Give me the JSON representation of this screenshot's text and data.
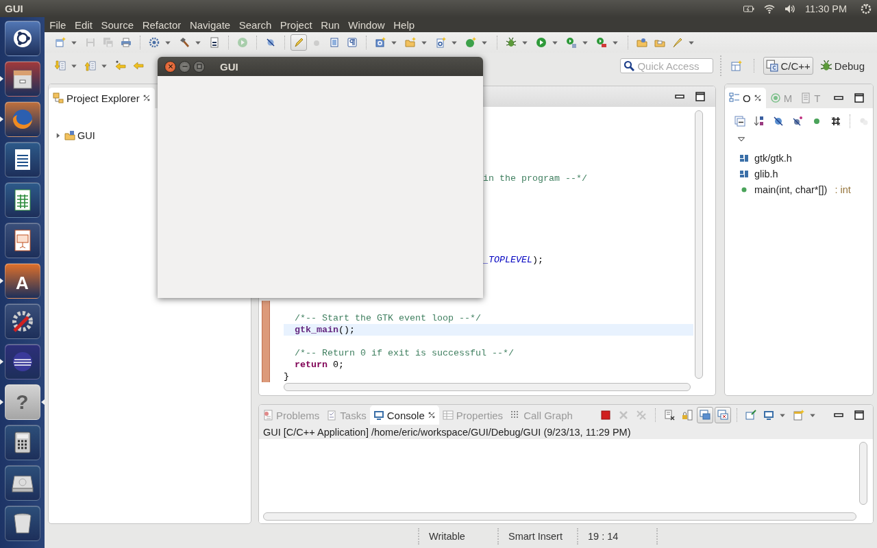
{
  "top_panel": {
    "app_title": "GUI",
    "clock": "11:30 PM"
  },
  "launcher": [
    {
      "kind": "ubuntu",
      "running": false,
      "focused": false
    },
    {
      "kind": "files",
      "running": true,
      "focused": false
    },
    {
      "kind": "firefox",
      "running": true,
      "focused": false
    },
    {
      "kind": "writer",
      "running": false,
      "focused": false
    },
    {
      "kind": "calc",
      "running": false,
      "focused": false
    },
    {
      "kind": "impress",
      "running": false,
      "focused": false
    },
    {
      "kind": "software",
      "running": true,
      "focused": false,
      "glyph": "A"
    },
    {
      "kind": "settings",
      "running": false,
      "focused": false
    },
    {
      "kind": "eclipse",
      "running": true,
      "focused": false
    },
    {
      "kind": "help",
      "running": true,
      "focused": true,
      "glyph": "?"
    },
    {
      "kind": "calculator",
      "running": false,
      "focused": false
    },
    {
      "kind": "disk",
      "running": false,
      "focused": false
    },
    {
      "kind": "trash",
      "running": false,
      "focused": false
    }
  ],
  "menu": [
    "File",
    "Edit",
    "Source",
    "Refactor",
    "Navigate",
    "Search",
    "Project",
    "Run",
    "Window",
    "Help"
  ],
  "toolbar_main": [
    {
      "kind": "new",
      "disabled": false,
      "pressed": false,
      "dropdown": true
    },
    {
      "kind": "save",
      "disabled": true,
      "pressed": false,
      "dropdown": false
    },
    {
      "kind": "saveall",
      "disabled": true,
      "pressed": false,
      "dropdown": false
    },
    {
      "kind": "print",
      "disabled": false,
      "pressed": false,
      "dropdown": false
    },
    {
      "kind": "separator"
    },
    {
      "kind": "gear",
      "disabled": false,
      "pressed": false,
      "dropdown": true
    },
    {
      "kind": "hammer",
      "disabled": false,
      "pressed": false,
      "dropdown": true
    },
    {
      "kind": "binary",
      "disabled": false,
      "pressed": false,
      "dropdown": false
    },
    {
      "kind": "separator"
    },
    {
      "kind": "play",
      "disabled": true,
      "pressed": false,
      "dropdown": false
    },
    {
      "kind": "separator"
    },
    {
      "kind": "marker",
      "disabled": false,
      "pressed": false,
      "dropdown": false
    },
    {
      "kind": "separator"
    },
    {
      "kind": "pen",
      "disabled": false,
      "pressed": true,
      "dropdown": false
    },
    {
      "kind": "dot",
      "disabled": true,
      "pressed": false,
      "dropdown": false
    },
    {
      "kind": "block",
      "disabled": false,
      "pressed": false,
      "dropdown": false
    },
    {
      "kind": "para",
      "disabled": false,
      "pressed": false,
      "dropdown": false
    },
    {
      "kind": "separator"
    },
    {
      "kind": "newclass",
      "disabled": false,
      "pressed": false,
      "dropdown": true
    },
    {
      "kind": "newfolder",
      "disabled": false,
      "pressed": false,
      "dropdown": true
    },
    {
      "kind": "newsrc",
      "disabled": false,
      "pressed": false,
      "dropdown": true
    },
    {
      "kind": "newcpp",
      "disabled": false,
      "pressed": false,
      "dropdown": true
    },
    {
      "kind": "separator"
    },
    {
      "kind": "bug",
      "disabled": false,
      "pressed": false,
      "dropdown": true
    },
    {
      "kind": "play",
      "disabled": false,
      "pressed": false,
      "dropdown": true
    },
    {
      "kind": "profile",
      "disabled": false,
      "pressed": false,
      "dropdown": true
    },
    {
      "kind": "exttool",
      "disabled": false,
      "pressed": false,
      "dropdown": true
    },
    {
      "kind": "separator"
    },
    {
      "kind": "folderopen",
      "disabled": false,
      "pressed": false,
      "dropdown": false
    },
    {
      "kind": "folder",
      "disabled": false,
      "pressed": false,
      "dropdown": false
    },
    {
      "kind": "brush",
      "disabled": false,
      "pressed": false,
      "dropdown": true
    }
  ],
  "toolbar_nav": [
    {
      "kind": "nextann",
      "disabled": false,
      "pressed": false,
      "dropdown": true
    },
    {
      "kind": "prevann",
      "disabled": false,
      "pressed": false,
      "dropdown": true
    },
    {
      "kind": "lastedit",
      "disabled": false,
      "pressed": false,
      "dropdown": false
    },
    {
      "kind": "back",
      "disabled": false,
      "pressed": false,
      "dropdown": false
    }
  ],
  "quick_access": {
    "placeholder": "Quick Access"
  },
  "perspectives": [
    {
      "kind": "cpp",
      "label": "C/C++",
      "selected": true
    },
    {
      "kind": "debug",
      "label": "Debug",
      "selected": false
    }
  ],
  "project_explorer": {
    "title": "Project Explorer",
    "tree": [
      {
        "label": "GUI",
        "expanded": false
      }
    ]
  },
  "editor": {
    "lines": [
      {
        "current": false
      },
      {
        "current": false
      },
      {
        "current": false
      },
      {
        "current": false
      },
      {
        "current": false
      },
      {
        "current": false,
        "covered": true,
        "segments": [
          {
            "kind": "comment",
            "text": "in the program --*/"
          }
        ]
      },
      {
        "current": false
      },
      {
        "current": false
      },
      {
        "current": false
      },
      {
        "current": false
      },
      {
        "current": false
      },
      {
        "current": false
      },
      {
        "current": false,
        "covered": true,
        "segments": [
          {
            "kind": "constant",
            "text": "_TOPLEVEL"
          },
          {
            "kind": "plain",
            "text": ");"
          }
        ]
      },
      {
        "current": false
      },
      {
        "current": false
      },
      {
        "current": false
      },
      {
        "current": false,
        "changed": true
      },
      {
        "current": false,
        "changed": true,
        "segments": [
          {
            "kind": "comment",
            "text": "  /*-- Start the GTK event loop --*/"
          }
        ]
      },
      {
        "current": true,
        "changed": true,
        "segments": [
          {
            "kind": "function",
            "text": "  gtk_main"
          },
          {
            "kind": "plain",
            "text": "();"
          }
        ]
      },
      {
        "current": false,
        "changed": true
      },
      {
        "current": false,
        "changed": true,
        "segments": [
          {
            "kind": "comment",
            "text": "  /*-- Return 0 if exit is successful --*/"
          }
        ]
      },
      {
        "current": false,
        "changed": true,
        "segments": [
          {
            "kind": "keyword",
            "text": "  return"
          },
          {
            "kind": "plain",
            "text": " 0;"
          }
        ]
      },
      {
        "current": false,
        "changed": true,
        "segments": [
          {
            "kind": "plain",
            "text": "}"
          }
        ]
      }
    ]
  },
  "outline": {
    "tabs": [
      {
        "kind": "outline",
        "label": "O",
        "selected": true
      },
      {
        "kind": "make",
        "label": "M",
        "selected": false
      },
      {
        "kind": "task",
        "label": "T",
        "selected": false
      }
    ],
    "toolbar": [
      {
        "kind": "collapse",
        "disabled": false
      },
      {
        "kind": "sort",
        "disabled": false
      },
      {
        "kind": "hidefields",
        "disabled": false
      },
      {
        "kind": "hidestatic",
        "disabled": false
      },
      {
        "kind": "greendot",
        "disabled": false
      },
      {
        "kind": "hash",
        "disabled": false
      },
      {
        "kind": "separator"
      },
      {
        "kind": "group",
        "disabled": true
      }
    ],
    "items": [
      {
        "kind": "include",
        "label": "gtk/gtk.h"
      },
      {
        "kind": "include",
        "label": "glib.h"
      },
      {
        "kind": "function",
        "label": "main(int, char*[])",
        "type": ": int"
      }
    ]
  },
  "console": {
    "tabs": [
      {
        "kind": "problems",
        "label": "Problems",
        "selected": false
      },
      {
        "kind": "tasks",
        "label": "Tasks",
        "selected": false
      },
      {
        "kind": "console",
        "label": "Console",
        "selected": true
      },
      {
        "kind": "properties",
        "label": "Properties",
        "selected": false
      },
      {
        "kind": "callgraph",
        "label": "Call Graph",
        "selected": false
      }
    ],
    "toolbar": [
      {
        "kind": "stop",
        "disabled": false,
        "pressed": false,
        "dropdown": false
      },
      {
        "kind": "xmark",
        "disabled": true,
        "pressed": false,
        "dropdown": false
      },
      {
        "kind": "xxmark",
        "disabled": true,
        "pressed": false,
        "dropdown": false
      },
      {
        "kind": "separator"
      },
      {
        "kind": "docx",
        "disabled": false,
        "pressed": false,
        "dropdown": false
      },
      {
        "kind": "lock",
        "disabled": false,
        "pressed": false,
        "dropdown": false
      },
      {
        "kind": "stdout",
        "disabled": false,
        "pressed": true,
        "dropdown": false
      },
      {
        "kind": "stderr",
        "disabled": false,
        "pressed": true,
        "dropdown": false
      },
      {
        "kind": "separator"
      },
      {
        "kind": "pin",
        "disabled": false,
        "pressed": false,
        "dropdown": false
      },
      {
        "kind": "monitor",
        "disabled": false,
        "pressed": false,
        "dropdown": true
      },
      {
        "kind": "newwin",
        "disabled": false,
        "pressed": false,
        "dropdown": true
      }
    ],
    "description": "GUI [C/C++ Application] /home/eric/workspace/GUI/Debug/GUI (9/23/13, 11:29 PM)"
  },
  "status_bar": [
    "Writable",
    "Smart Insert",
    "19 : 14"
  ],
  "gui_window": {
    "title": "GUI"
  }
}
